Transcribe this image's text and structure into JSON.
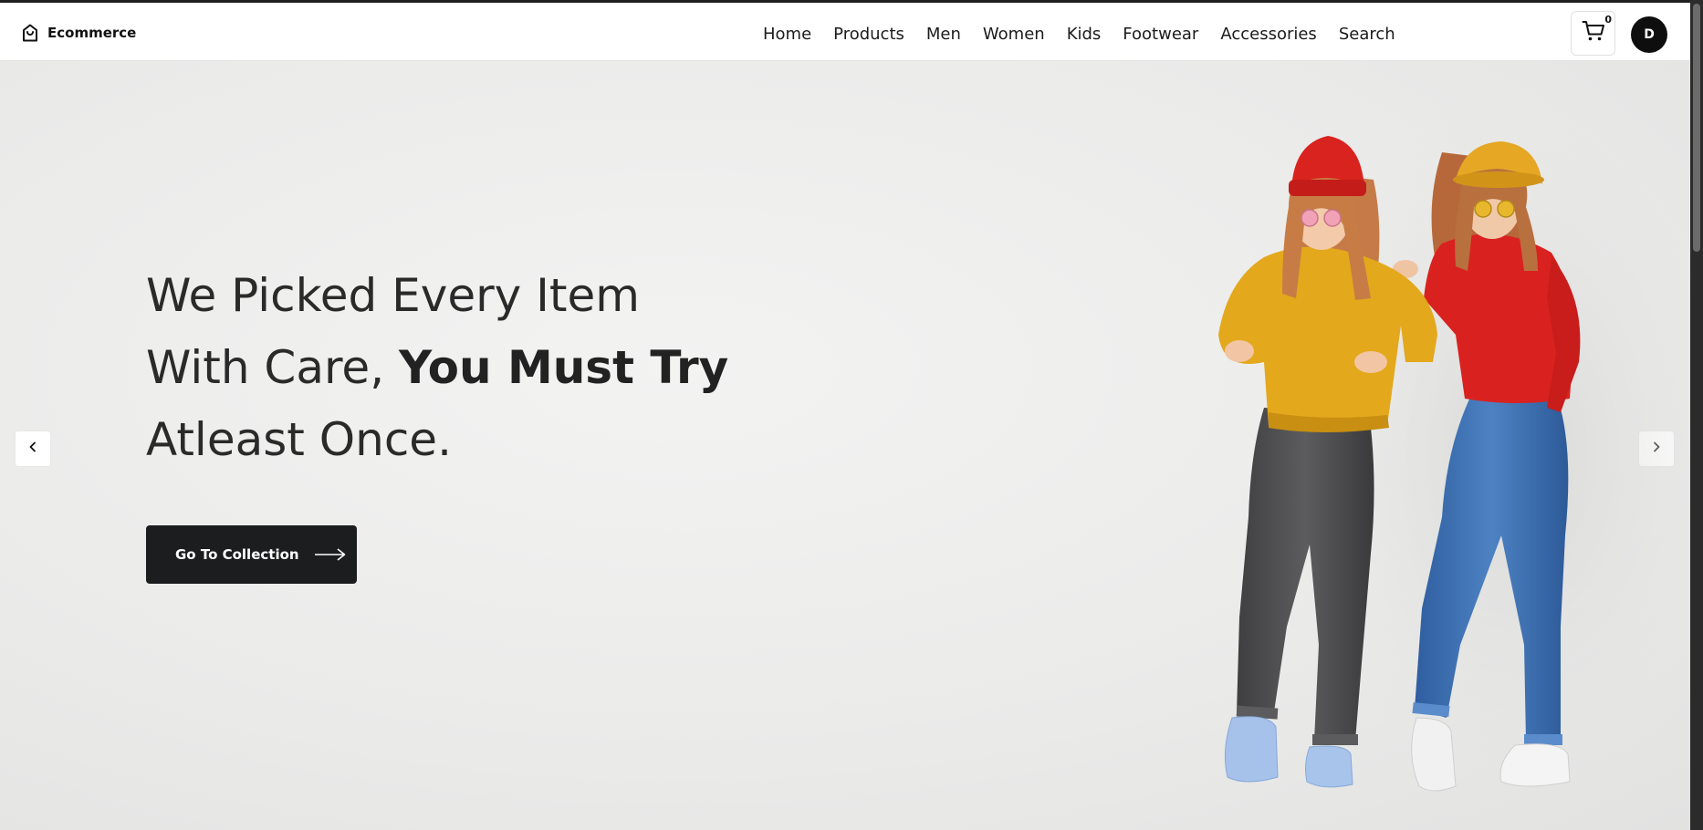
{
  "header": {
    "brand": {
      "name": "Ecommerce",
      "icon": "shopping-bag-icon"
    },
    "nav": [
      {
        "id": "home",
        "label": "Home"
      },
      {
        "id": "products",
        "label": "Products"
      },
      {
        "id": "men",
        "label": "Men"
      },
      {
        "id": "women",
        "label": "Women"
      },
      {
        "id": "kids",
        "label": "Kids"
      },
      {
        "id": "footwear",
        "label": "Footwear"
      },
      {
        "id": "accessories",
        "label": "Accessories"
      },
      {
        "id": "search",
        "label": "Search"
      }
    ],
    "cart": {
      "icon": "cart-icon",
      "count": "0"
    },
    "user": {
      "initial": "D"
    }
  },
  "hero": {
    "headline": {
      "line1": "We Picked Every Item",
      "line2_normal": "With Care, ",
      "line2_bold": "You Must Try",
      "line3": "Atleast Once."
    },
    "cta": {
      "label": "Go To Collection",
      "icon": "arrow-right-long-icon"
    },
    "prev_icon": "chevron-left-icon",
    "next_icon": "chevron-right-icon",
    "image_icon": "two-women-fashion-photo"
  },
  "colors": {
    "accent_dark": "#1c1d1e",
    "hero_bg": "#ececeb",
    "sweater_yellow": "#e3a81c",
    "sweater_red": "#d9221f",
    "jeans_grey": "#4f4f51",
    "jeans_blue": "#3c6fb0"
  }
}
